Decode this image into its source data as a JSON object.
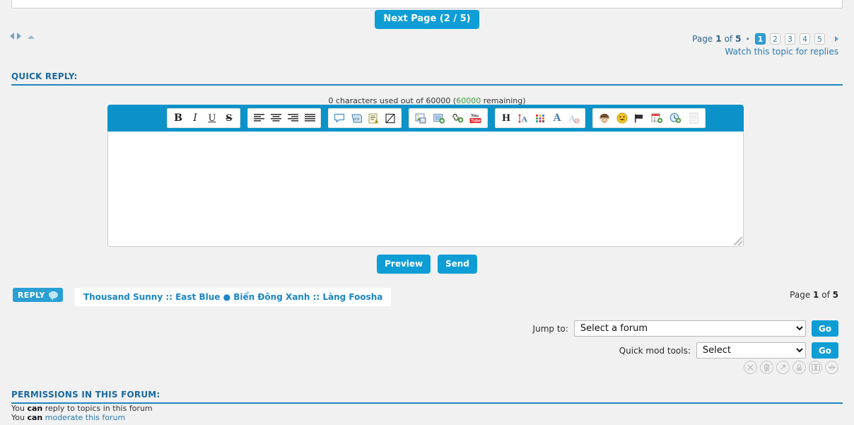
{
  "top": {
    "next_page_label": "Next Page (2 / 5)"
  },
  "nav_arrows": {
    "prev": "arrow-left",
    "next": "arrow-right",
    "top": "arrow-up"
  },
  "pagination": {
    "prefix": "Page",
    "current": "1",
    "of": "of",
    "total": "5",
    "separator": "•",
    "pages": [
      "1",
      "2",
      "3",
      "4",
      "5"
    ],
    "active_page": "1",
    "watch_link": "Watch this topic for replies"
  },
  "quick_reply": {
    "heading": "QUICK REPLY:",
    "char_count_pre": "0 characters used out of 60000 (",
    "char_count_remaining": "60000",
    "char_count_post": " remaining)",
    "textarea_value": "",
    "textarea_placeholder": "",
    "preview_label": "Preview",
    "send_label": "Send"
  },
  "toolbar": {
    "groups": [
      {
        "name": "text-style",
        "buttons": [
          {
            "name": "bold-icon",
            "glyph": "B",
            "title": "Bold"
          },
          {
            "name": "italic-icon",
            "glyph": "I",
            "title": "Italic"
          },
          {
            "name": "underline-icon",
            "glyph": "U",
            "title": "Underline"
          },
          {
            "name": "strikethrough-icon",
            "glyph": "S",
            "title": "Strikethrough"
          }
        ]
      },
      {
        "name": "alignment",
        "buttons": [
          {
            "name": "align-left-icon",
            "glyph": "",
            "title": "Align left"
          },
          {
            "name": "align-center-icon",
            "glyph": "",
            "title": "Align center"
          },
          {
            "name": "align-right-icon",
            "glyph": "",
            "title": "Align right"
          },
          {
            "name": "align-justify-icon",
            "glyph": "",
            "title": "Justify"
          }
        ]
      },
      {
        "name": "blocks",
        "buttons": [
          {
            "name": "quote-icon",
            "glyph": "",
            "title": "Quote"
          },
          {
            "name": "code-icon",
            "glyph": "",
            "title": "Code"
          },
          {
            "name": "list-icon",
            "glyph": "",
            "title": "List"
          },
          {
            "name": "spoiler-icon",
            "glyph": "",
            "title": "Spoiler"
          }
        ]
      },
      {
        "name": "media",
        "buttons": [
          {
            "name": "insert-image-icon",
            "glyph": "",
            "title": "Insert image"
          },
          {
            "name": "host-image-icon",
            "glyph": "",
            "title": "Host an image"
          },
          {
            "name": "insert-link-icon",
            "glyph": "",
            "title": "Insert link"
          },
          {
            "name": "youtube-icon",
            "glyph": "You",
            "glyph2": "Tube",
            "title": "Insert video"
          }
        ]
      },
      {
        "name": "font",
        "buttons": [
          {
            "name": "heading-icon",
            "glyph": "H",
            "title": "Heading"
          },
          {
            "name": "font-size-icon",
            "glyph": "A",
            "title": "Font size"
          },
          {
            "name": "font-color-icon",
            "glyph": "",
            "title": "Font color"
          },
          {
            "name": "font-face-icon",
            "glyph": "A",
            "title": "Font face"
          },
          {
            "name": "remove-format-icon",
            "glyph": "A",
            "title": "Remove formatting"
          }
        ]
      },
      {
        "name": "extras",
        "buttons": [
          {
            "name": "avatar-smiley-icon",
            "glyph": "",
            "title": "Avatar smiley"
          },
          {
            "name": "smiley-icon",
            "glyph": "",
            "title": "Smilies"
          },
          {
            "name": "flag-icon",
            "glyph": "",
            "title": "Flag"
          },
          {
            "name": "calendar-icon",
            "glyph": "",
            "title": "Insert date"
          },
          {
            "name": "clock-icon",
            "glyph": "",
            "title": "Insert time"
          },
          {
            "name": "page-icon",
            "glyph": "",
            "title": "Page",
            "disabled": true
          }
        ]
      }
    ]
  },
  "bottom": {
    "reply_label": "REPLY",
    "breadcrumb": "Thousand Sunny :: East Blue ● Biển Đông Xanh :: Làng Foosha",
    "page_prefix": "Page",
    "page_current": "1",
    "page_of": "of",
    "page_total": "5"
  },
  "jump_to": {
    "label": "Jump to:",
    "selected": "Select a forum",
    "options": [
      "Select a forum"
    ],
    "go_label": "Go"
  },
  "quick_mod": {
    "label": "Quick mod tools:",
    "selected": "Select",
    "options": [
      "Select"
    ],
    "go_label": "Go"
  },
  "mod_icons": [
    {
      "name": "close-topic-icon",
      "title": "Close topic"
    },
    {
      "name": "delete-topic-icon",
      "title": "Delete topic"
    },
    {
      "name": "move-topic-icon",
      "title": "Move topic"
    },
    {
      "name": "lock-topic-icon",
      "title": "Lock topic"
    },
    {
      "name": "split-topic-icon",
      "title": "Split topic"
    },
    {
      "name": "merge-topic-icon",
      "title": "Merge topic"
    }
  ],
  "permissions": {
    "heading": "PERMISSIONS IN THIS FORUM:",
    "line1_pre": "You ",
    "line1_bold": "can",
    "line1_post": " reply to topics in this forum",
    "line2_pre": "You ",
    "line2_bold": "can",
    "line2_link": "moderate this forum"
  },
  "colors": {
    "accent": "#0e9ed5",
    "toolbar": "#0b93c9",
    "heading": "#1a69a0",
    "link": "#2a7ab0",
    "page_bg": "#f1f1f1",
    "remaining": "#3a9e3a"
  }
}
